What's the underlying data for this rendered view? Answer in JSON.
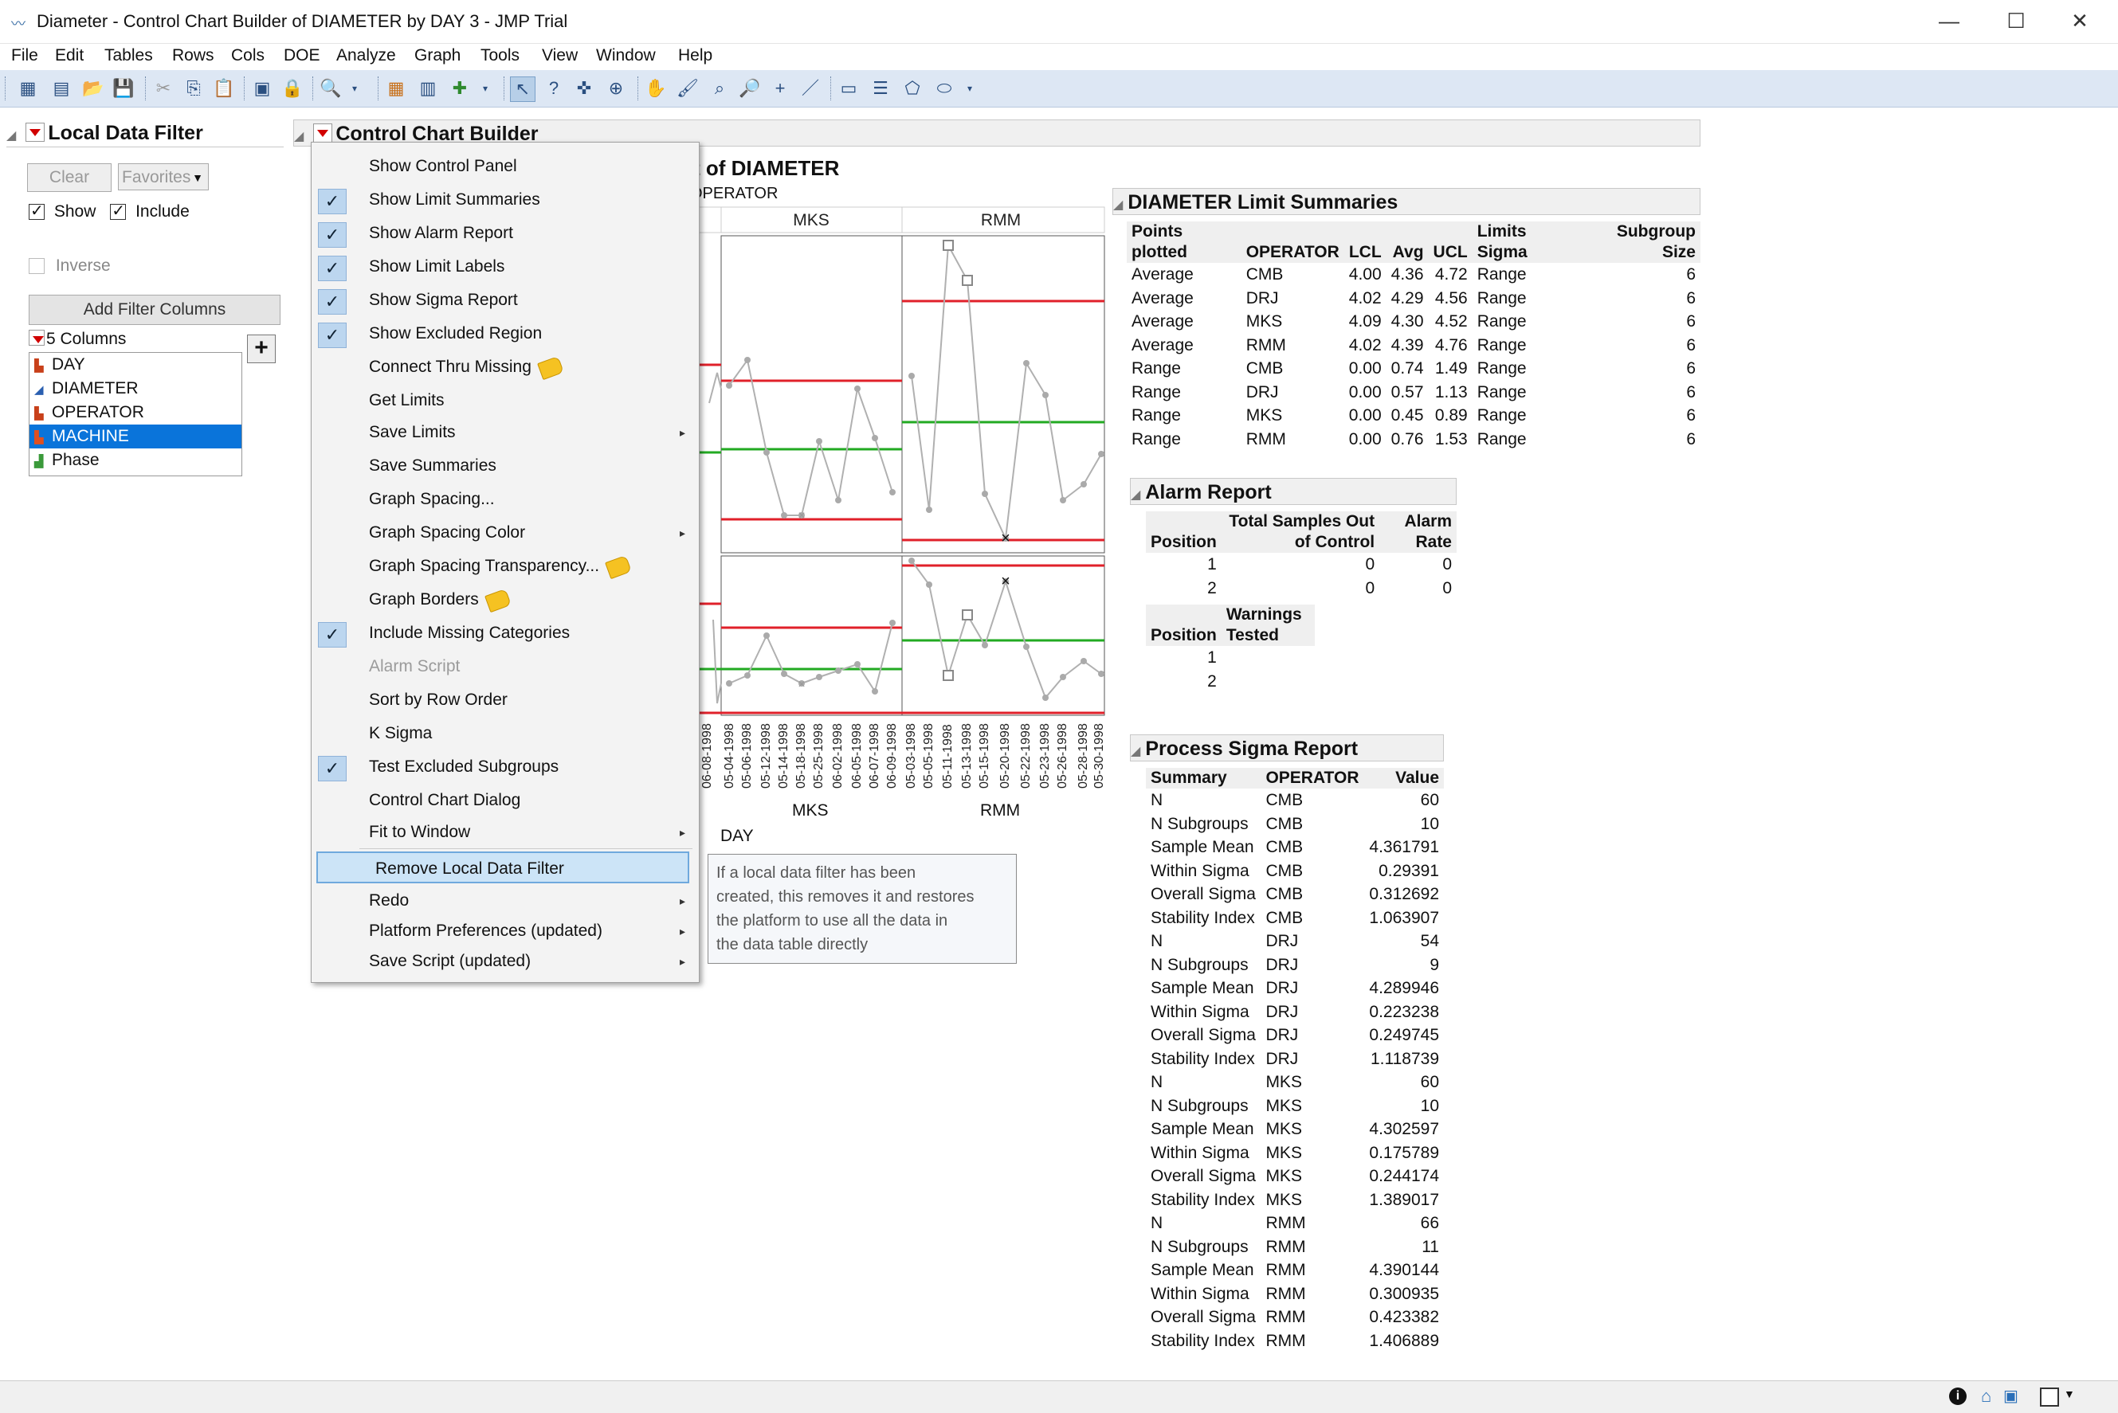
{
  "window": {
    "title": "Diameter - Control Chart Builder of DIAMETER by DAY 3 - JMP Trial",
    "minimize": "—",
    "maximize": "☐",
    "close": "✕"
  },
  "menubar": [
    "File",
    "Edit",
    "Tables",
    "Rows",
    "Cols",
    "DOE",
    "Analyze",
    "Graph",
    "Tools",
    "View",
    "Window",
    "Help"
  ],
  "toolbar_icons": [
    "new-table-icon",
    "new-script-icon",
    "open-icon",
    "save-icon",
    "cut-icon",
    "copy-icon",
    "paste-icon",
    "journal-icon",
    "lock-icon",
    "search-icon",
    "data-table-icon",
    "columns-icon",
    "add-icon",
    "arrow-tool-icon",
    "help-tool-icon",
    "crosshair-tool-icon",
    "lasso-icon",
    "hand-tool-icon",
    "brush-tool-icon",
    "selection-icon",
    "zoom-icon",
    "plus-icon",
    "line-tool-icon",
    "annotate-icon",
    "separator-icon",
    "polygon-icon",
    "ellipse-icon"
  ],
  "local_data_filter": {
    "title": "Local Data Filter",
    "clear_label": "Clear",
    "favorites_label": "Favorites",
    "show_label": "Show",
    "include_label": "Include",
    "inverse_label": "Inverse",
    "add_filter_label": "Add Filter Columns",
    "columns_header": "5 Columns",
    "columns": [
      "DAY",
      "DIAMETER",
      "OPERATOR",
      "MACHINE",
      "Phase"
    ],
    "selected_column": "MACHINE"
  },
  "control_chart_builder": {
    "title": "Control Chart Builder",
    "chart_title_partial": "t of DIAMETER",
    "operator_partial": "OPERATOR",
    "panels": [
      "MKS",
      "RMM"
    ],
    "bottom_axis_label": "DAY",
    "bottom_panels": [
      "MKS",
      "RMM"
    ],
    "left_date_label": "06-08-1998",
    "mks_dates": [
      "05-04-1998",
      "05-06-1998",
      "05-12-1998",
      "05-14-1998",
      "05-18-1998",
      "05-25-1998",
      "06-02-1998",
      "06-05-1998",
      "06-07-1998",
      "06-09-1998"
    ],
    "rmm_dates": [
      "05-03-1998",
      "05-05-1998",
      "05-11-1998",
      "05-13-1998",
      "05-15-1998",
      "05-20-1998",
      "05-22-1998",
      "05-23-1998",
      "05-26-1998",
      "05-28-1998",
      "05-30-1998"
    ]
  },
  "context_menu": {
    "items": [
      {
        "label": "Show Control Panel",
        "checked": false
      },
      {
        "label": "Show Limit Summaries",
        "checked": true
      },
      {
        "label": "Show Alarm Report",
        "checked": true
      },
      {
        "label": "Show Limit Labels",
        "checked": true
      },
      {
        "label": "Show Sigma Report",
        "checked": true
      },
      {
        "label": "Show Excluded Region",
        "checked": true
      },
      {
        "label": "Connect Thru Missing",
        "checked": false,
        "tag": true
      },
      {
        "label": "Get Limits",
        "checked": false
      },
      {
        "label": "Save Limits",
        "checked": false,
        "submenu": true
      },
      {
        "label": "Save Summaries",
        "checked": false
      },
      {
        "label": "Graph Spacing...",
        "checked": false
      },
      {
        "label": "Graph Spacing Color",
        "checked": false,
        "submenu": true
      },
      {
        "label": "Graph Spacing Transparency...",
        "checked": false,
        "tag": true
      },
      {
        "label": "Graph Borders",
        "checked": false,
        "tag": true
      },
      {
        "label": "Include Missing Categories",
        "checked": true
      },
      {
        "label": "Alarm Script",
        "checked": false,
        "disabled": true
      },
      {
        "label": "Sort by Row Order",
        "checked": false
      },
      {
        "label": "K Sigma",
        "checked": false
      },
      {
        "label": "Test Excluded Subgroups",
        "checked": true
      },
      {
        "label": "Control Chart Dialog",
        "checked": false
      },
      {
        "label": "Fit to Window",
        "checked": false,
        "submenu": true
      },
      {
        "label": "Remove Local Data Filter",
        "checked": false,
        "highlighted": true
      },
      {
        "label": "Redo",
        "checked": false,
        "submenu": true
      },
      {
        "label": "Platform Preferences (updated)",
        "checked": false,
        "submenu": true
      },
      {
        "label": "Save Script (updated)",
        "checked": false,
        "submenu": true
      }
    ],
    "tooltip": [
      "If a local data filter has been",
      "created, this removes it and restores",
      "the platform to use all the data in",
      "the data table directly"
    ]
  },
  "limit_summaries": {
    "title": "DIAMETER Limit Summaries",
    "headers": [
      "Points plotted",
      "OPERATOR",
      "LCL",
      "Avg",
      "UCL",
      "Limits Sigma",
      "Subgroup Size"
    ],
    "rows": [
      [
        "Average",
        "CMB",
        "4.00",
        "4.36",
        "4.72",
        "Range",
        "6"
      ],
      [
        "Average",
        "DRJ",
        "4.02",
        "4.29",
        "4.56",
        "Range",
        "6"
      ],
      [
        "Average",
        "MKS",
        "4.09",
        "4.30",
        "4.52",
        "Range",
        "6"
      ],
      [
        "Average",
        "RMM",
        "4.02",
        "4.39",
        "4.76",
        "Range",
        "6"
      ],
      [
        "Range",
        "CMB",
        "0.00",
        "0.74",
        "1.49",
        "Range",
        "6"
      ],
      [
        "Range",
        "DRJ",
        "0.00",
        "0.57",
        "1.13",
        "Range",
        "6"
      ],
      [
        "Range",
        "MKS",
        "0.00",
        "0.45",
        "0.89",
        "Range",
        "6"
      ],
      [
        "Range",
        "RMM",
        "0.00",
        "0.76",
        "1.53",
        "Range",
        "6"
      ]
    ]
  },
  "alarm_report": {
    "title": "Alarm Report",
    "headers": [
      "Position",
      "Total Samples Out of Control",
      "Alarm Rate"
    ],
    "rows": [
      [
        "1",
        "0",
        "0"
      ],
      [
        "2",
        "0",
        "0"
      ]
    ],
    "headers2": [
      "Position",
      "Warnings Tested"
    ],
    "rows2": [
      [
        "1",
        ""
      ],
      [
        "2",
        ""
      ]
    ]
  },
  "sigma_report": {
    "title": "Process Sigma Report",
    "headers": [
      "Summary",
      "OPERATOR",
      "Value"
    ],
    "rows": [
      [
        "N",
        "CMB",
        "60"
      ],
      [
        "N Subgroups",
        "CMB",
        "10"
      ],
      [
        "Sample Mean",
        "CMB",
        "4.361791"
      ],
      [
        "Within Sigma",
        "CMB",
        "0.29391"
      ],
      [
        "Overall Sigma",
        "CMB",
        "0.312692"
      ],
      [
        "Stability Index",
        "CMB",
        "1.063907"
      ],
      [
        "N",
        "DRJ",
        "54"
      ],
      [
        "N Subgroups",
        "DRJ",
        "9"
      ],
      [
        "Sample Mean",
        "DRJ",
        "4.289946"
      ],
      [
        "Within Sigma",
        "DRJ",
        "0.223238"
      ],
      [
        "Overall Sigma",
        "DRJ",
        "0.249745"
      ],
      [
        "Stability Index",
        "DRJ",
        "1.118739"
      ],
      [
        "N",
        "MKS",
        "60"
      ],
      [
        "N Subgroups",
        "MKS",
        "10"
      ],
      [
        "Sample Mean",
        "MKS",
        "4.302597"
      ],
      [
        "Within Sigma",
        "MKS",
        "0.175789"
      ],
      [
        "Overall Sigma",
        "MKS",
        "0.244174"
      ],
      [
        "Stability Index",
        "MKS",
        "1.389017"
      ],
      [
        "N",
        "RMM",
        "66"
      ],
      [
        "N Subgroups",
        "RMM",
        "11"
      ],
      [
        "Sample Mean",
        "RMM",
        "4.390144"
      ],
      [
        "Within Sigma",
        "RMM",
        "0.300935"
      ],
      [
        "Overall Sigma",
        "RMM",
        "0.423382"
      ],
      [
        "Stability Index",
        "RMM",
        "1.406889"
      ]
    ]
  },
  "colors": {
    "limit_line": "#e0202a",
    "center_line": "#22aa22",
    "data_line": "#b0b0b0",
    "selection": "#0a74da",
    "toolbar_bg": "#dde7f4",
    "menu_highlight": "#cce4f7"
  }
}
